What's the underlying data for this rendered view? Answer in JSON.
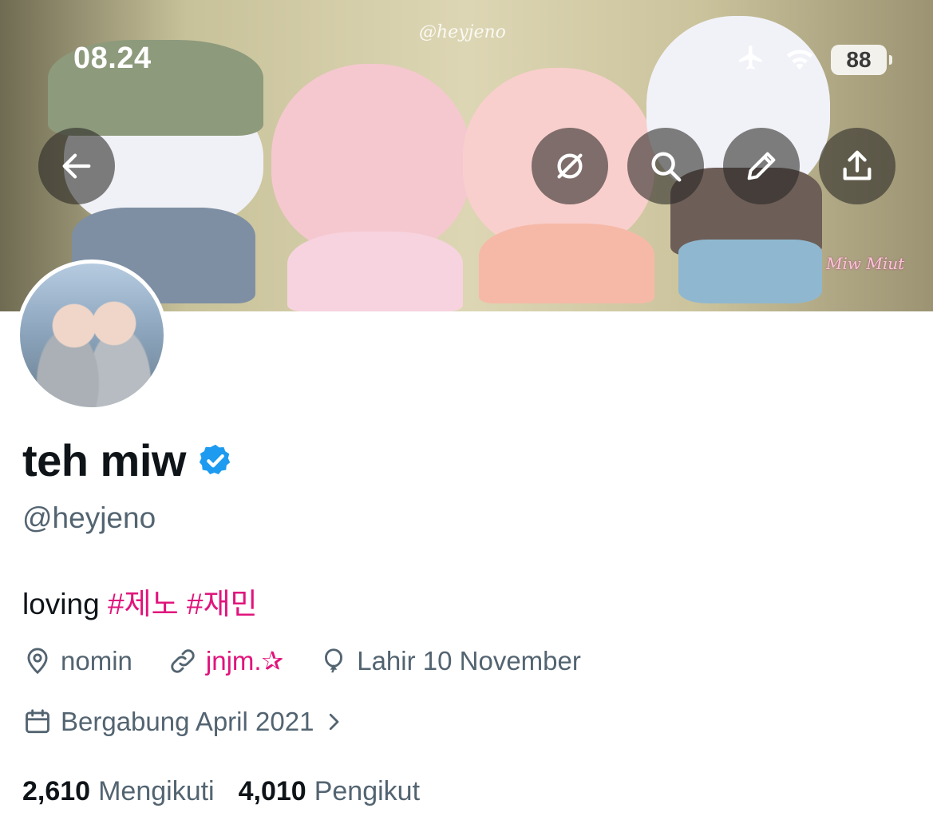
{
  "status_bar": {
    "time": "08.24",
    "battery": "88"
  },
  "banner": {
    "watermark_top": "@heyjeno",
    "watermark_corner": "Miw Miut"
  },
  "profile": {
    "display_name": "teh miw",
    "handle": "@heyjeno",
    "bio_text": "loving",
    "bio_tags": [
      "#제노",
      "#재민"
    ],
    "location": "nomin",
    "link": "jnjm.✰",
    "birthday": "Lahir 10 November",
    "joined": "Bergabung April 2021",
    "following_count": "2,610",
    "following_label": "Mengikuti",
    "followers_count": "4,010",
    "followers_label": "Pengikut"
  },
  "colors": {
    "accent": "#e0157c",
    "verified": "#1d9bf0",
    "secondary_text": "#536471"
  },
  "icons": [
    "back-arrow-icon",
    "grok-icon",
    "search-icon",
    "edit-icon",
    "share-icon",
    "location-icon",
    "link-icon",
    "balloon-icon",
    "calendar-icon",
    "chevron-right-icon",
    "verified-badge-icon",
    "airplane-icon",
    "wifi-icon"
  ]
}
